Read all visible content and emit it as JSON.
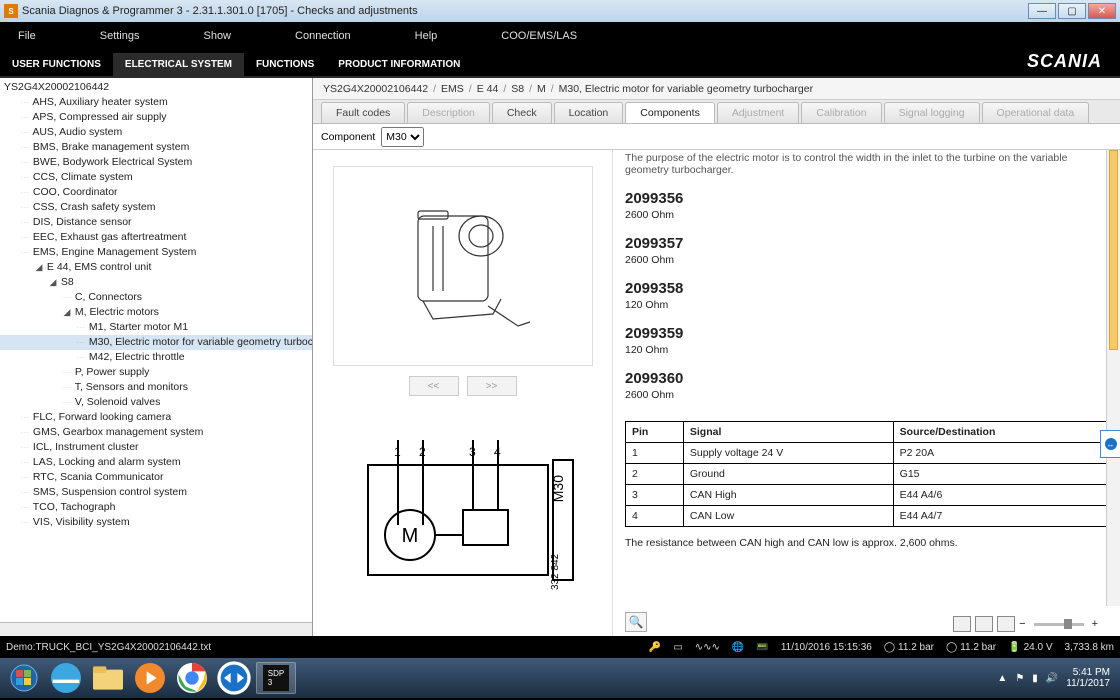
{
  "window": {
    "title": "Scania Diagnos & Programmer 3  -  2.31.1.301.0 [1705]  -  Checks and adjustments",
    "app_badge": "SDP3"
  },
  "menu": [
    "File",
    "Settings",
    "Show",
    "Connection",
    "Help",
    "COO/EMS/LAS"
  ],
  "nav": {
    "tabs": [
      "USER FUNCTIONS",
      "ELECTRICAL SYSTEM",
      "FUNCTIONS",
      "PRODUCT INFORMATION"
    ],
    "active": 1,
    "brand": "SCANIA"
  },
  "tree": {
    "root": "YS2G4X20002106442",
    "items": [
      {
        "t": "AHS, Auxiliary heater system",
        "d": 1
      },
      {
        "t": "APS, Compressed air supply",
        "d": 1
      },
      {
        "t": "AUS, Audio system",
        "d": 1
      },
      {
        "t": "BMS, Brake management system",
        "d": 1
      },
      {
        "t": "BWE, Bodywork Electrical System",
        "d": 1
      },
      {
        "t": "CCS, Climate system",
        "d": 1
      },
      {
        "t": "COO, Coordinator",
        "d": 1
      },
      {
        "t": "CSS, Crash safety system",
        "d": 1
      },
      {
        "t": "DIS, Distance sensor",
        "d": 1
      },
      {
        "t": "EEC, Exhaust gas aftertreatment",
        "d": 1
      },
      {
        "t": "EMS, Engine Management System",
        "d": 1
      },
      {
        "t": "E 44, EMS control unit",
        "d": 2,
        "tw": "◢"
      },
      {
        "t": "S8",
        "d": 3,
        "tw": "◢"
      },
      {
        "t": "C, Connectors",
        "d": 4
      },
      {
        "t": "M, Electric motors",
        "d": 4,
        "tw": "◢"
      },
      {
        "t": "M1, Starter motor M1",
        "d": 5
      },
      {
        "t": "M30, Electric motor for variable geometry turbocharger",
        "d": 5,
        "sel": true
      },
      {
        "t": "M42, Electric throttle",
        "d": 5
      },
      {
        "t": "P, Power supply",
        "d": 4
      },
      {
        "t": "T, Sensors and monitors",
        "d": 4
      },
      {
        "t": "V, Solenoid valves",
        "d": 4
      },
      {
        "t": "FLC, Forward looking camera",
        "d": 1
      },
      {
        "t": "GMS, Gearbox management system",
        "d": 1
      },
      {
        "t": "ICL, Instrument cluster",
        "d": 1
      },
      {
        "t": "LAS, Locking and alarm system",
        "d": 1
      },
      {
        "t": "RTC, Scania Communicator",
        "d": 1
      },
      {
        "t": "SMS, Suspension control system",
        "d": 1
      },
      {
        "t": "TCO, Tachograph",
        "d": 1
      },
      {
        "t": "VIS, Visibility system",
        "d": 1
      }
    ]
  },
  "breadcrumb": [
    "YS2G4X20002106442",
    "EMS",
    "E 44",
    "S8",
    "M",
    "M30, Electric motor for variable geometry turbocharger"
  ],
  "subtabs": [
    {
      "label": "Fault codes",
      "state": "normal"
    },
    {
      "label": "Description",
      "state": "disabled"
    },
    {
      "label": "Check",
      "state": "normal"
    },
    {
      "label": "Location",
      "state": "normal"
    },
    {
      "label": "Components",
      "state": "active"
    },
    {
      "label": "Adjustment",
      "state": "disabled"
    },
    {
      "label": "Calibration",
      "state": "disabled"
    },
    {
      "label": "Signal logging",
      "state": "disabled"
    },
    {
      "label": "Operational data",
      "state": "disabled"
    }
  ],
  "component_picker": {
    "label": "Component",
    "value": "M30"
  },
  "pager": {
    "prev": "<<",
    "next": ">>"
  },
  "schematic_ref": "332 842",
  "schematic_name": "M30",
  "pin_numbers": [
    "1",
    "2",
    "3",
    "4"
  ],
  "truncated_note": "The purpose of the electric motor is to control the width in the inlet to the turbine on the variable geometry turbocharger.",
  "parts": [
    {
      "pn": "2099356",
      "ohm": "2600 Ohm"
    },
    {
      "pn": "2099357",
      "ohm": "2600 Ohm"
    },
    {
      "pn": "2099358",
      "ohm": "120 Ohm"
    },
    {
      "pn": "2099359",
      "ohm": "120 Ohm"
    },
    {
      "pn": "2099360",
      "ohm": "2600 Ohm"
    }
  ],
  "pins": {
    "headers": [
      "Pin",
      "Signal",
      "Source/Destination"
    ],
    "rows": [
      [
        "1",
        "Supply voltage 24 V",
        "P2 20A"
      ],
      [
        "2",
        "Ground",
        "G15"
      ],
      [
        "3",
        "CAN High",
        "E44 A4/6"
      ],
      [
        "4",
        "CAN Low",
        "E44 A4/7"
      ]
    ]
  },
  "footnote": "The resistance between CAN high and CAN low is approx. 2,600 ohms.",
  "status": {
    "demo": "Demo:TRUCK_BCI_YS2G4X20002106442.txt",
    "date": "11/10/2016 15:15:36",
    "bar1": "11.2 bar",
    "bar2": "11.2 bar",
    "volt": "24.0 V",
    "km": "3,733.8 km"
  },
  "tray": {
    "time": "5:41 PM",
    "date": "11/1/2017"
  }
}
